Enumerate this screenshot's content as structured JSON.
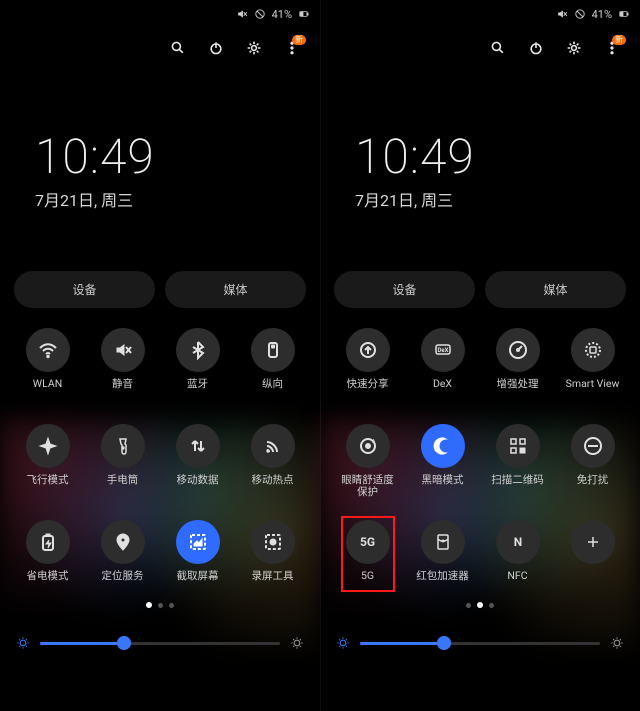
{
  "status": {
    "battery_text": "41%"
  },
  "clock": {
    "time": "10:49",
    "date": "7月21日, 周三"
  },
  "tabs": {
    "devices": "设备",
    "media": "媒体"
  },
  "iconrow": {
    "menu_badge": "新"
  },
  "left_tiles": [
    {
      "label": "WLAN",
      "icon": "wifi"
    },
    {
      "label": "静音",
      "icon": "mute"
    },
    {
      "label": "蓝牙",
      "icon": "bluetooth"
    },
    {
      "label": "纵向",
      "icon": "portrait"
    },
    {
      "label": "飞行模式",
      "icon": "plane"
    },
    {
      "label": "手电筒",
      "icon": "torch"
    },
    {
      "label": "移动数据",
      "icon": "data"
    },
    {
      "label": "移动热点",
      "icon": "hotspot"
    },
    {
      "label": "省电模式",
      "icon": "battery"
    },
    {
      "label": "定位服务",
      "icon": "location"
    },
    {
      "label": "截取屏幕",
      "icon": "screenshot",
      "on": true
    },
    {
      "label": "录屏工具",
      "icon": "record"
    }
  ],
  "right_tiles": [
    {
      "label": "快速分享",
      "icon": "share"
    },
    {
      "label": "DeX",
      "icon": "dex"
    },
    {
      "label": "增强处理",
      "icon": "gauge"
    },
    {
      "label": "Smart View",
      "icon": "cast"
    },
    {
      "label": "眼睛舒适度\n保护",
      "icon": "eye"
    },
    {
      "label": "黑暗模式",
      "icon": "moon",
      "on": true
    },
    {
      "label": "扫描二维码",
      "icon": "qr"
    },
    {
      "label": "免打扰",
      "icon": "dnd"
    },
    {
      "label": "5G",
      "icon": "5g",
      "highlight": true
    },
    {
      "label": "红包加速器",
      "icon": "redpacket"
    },
    {
      "label": "NFC",
      "icon": "nfc"
    },
    {
      "label": "",
      "icon": "plus"
    }
  ],
  "slider": {
    "left_value": 0.35,
    "right_value": 0.35
  },
  "pager": {
    "left_active": 0,
    "right_active": 1
  }
}
